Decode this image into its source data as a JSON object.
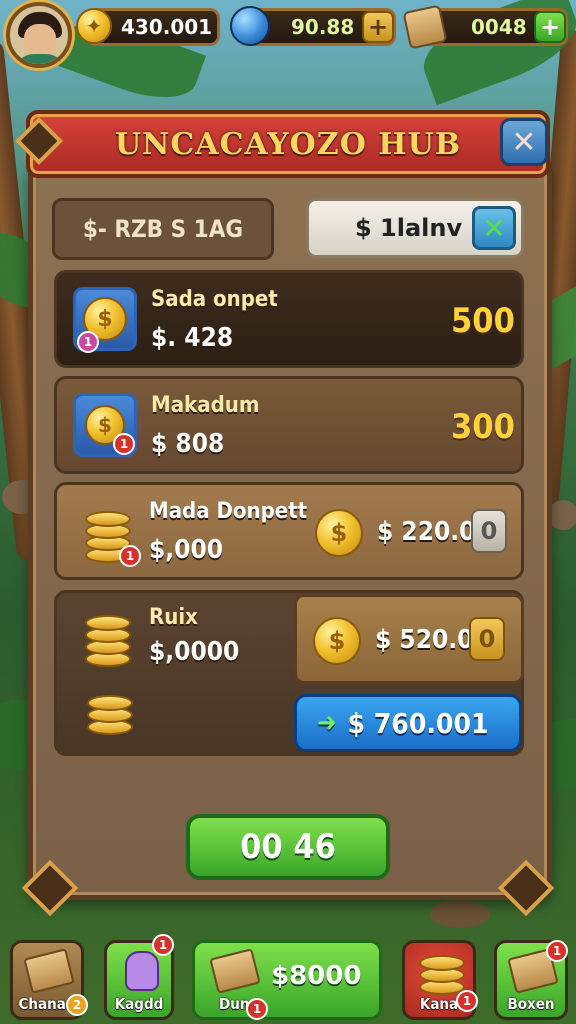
{
  "topbar": {
    "gold": {
      "value": "430.001",
      "icon": "coin-icon"
    },
    "gems": {
      "value": "90.88",
      "icon": "gem-icon"
    },
    "crates": {
      "value": "0048",
      "icon": "crate-icon"
    },
    "plus_symbol": "+"
  },
  "panel": {
    "title": "UNCACAYOZO HUB",
    "close_symbol": "✕",
    "filter_label": "$- RZB S 1AG",
    "search_value": "$ 1lalnv",
    "search_clear_symbol": "✕"
  },
  "offers": [
    {
      "name": "Sada onpet",
      "price": "$. 428",
      "amount": "500"
    },
    {
      "name": "Makadum",
      "price": "$ 808",
      "amount": "300"
    },
    {
      "name": "Mada Donpett",
      "price": "$,000",
      "sell_price": "$ 220.0",
      "sell_btn": "0"
    },
    {
      "name": "Ruix",
      "price": "$,0000",
      "sell_price": "$ 520.0",
      "sell_btn": "0",
      "buy_label": "$ 760.001"
    }
  ],
  "timer_label": "00 46",
  "coin_symbol": "$",
  "badges": [
    "1",
    "1",
    "1",
    "1",
    "1"
  ],
  "nav": [
    {
      "label": "Chanan",
      "badge": "2"
    },
    {
      "label": "Kagdd",
      "badge": "1"
    },
    {
      "label": "Dun",
      "value": "$8000",
      "badge": "1"
    },
    {
      "label": "Kana",
      "badge": "1"
    },
    {
      "label": "Boxen",
      "badge": "1"
    }
  ],
  "colors": {
    "title_banner": "#c8362e",
    "title_text": "#ffd561",
    "green_button": "#4bb831",
    "blue_button": "#2a88dc",
    "panel": "#846a4c"
  }
}
